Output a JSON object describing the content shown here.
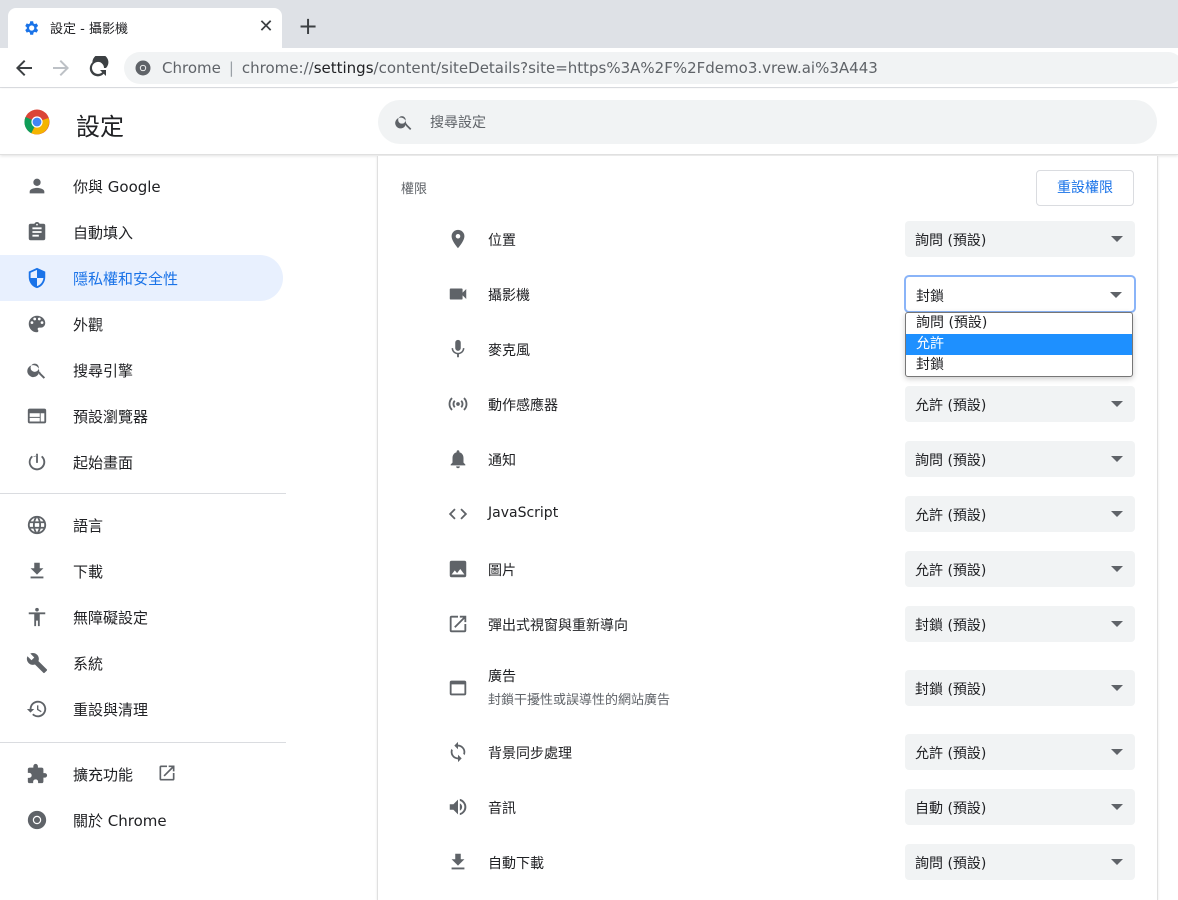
{
  "tab": {
    "title": "設定 - 攝影機",
    "close": "✕"
  },
  "newtab": "+",
  "omnibox": {
    "prefix": "Chrome",
    "separator": "|",
    "scheme": "chrome://",
    "host": "settings",
    "path": "/content/siteDetails?site=https%3A%2F%2Fdemo3.vrew.ai%3A443"
  },
  "header": {
    "title": "設定",
    "search_placeholder": "搜尋設定"
  },
  "sidebar": {
    "items": [
      {
        "label": "你與 Google",
        "icon": "person-icon"
      },
      {
        "label": "自動填入",
        "icon": "clipboard-icon"
      },
      {
        "label": "隱私權和安全性",
        "icon": "shield-icon"
      },
      {
        "label": "外觀",
        "icon": "palette-icon"
      },
      {
        "label": "搜尋引擎",
        "icon": "search-icon"
      },
      {
        "label": "預設瀏覽器",
        "icon": "browser-icon"
      },
      {
        "label": "起始畫面",
        "icon": "power-icon"
      },
      {
        "label": "語言",
        "icon": "globe-icon"
      },
      {
        "label": "下載",
        "icon": "download-icon"
      },
      {
        "label": "無障礙設定",
        "icon": "accessibility-icon"
      },
      {
        "label": "系統",
        "icon": "wrench-icon"
      },
      {
        "label": "重設與清理",
        "icon": "history-icon"
      },
      {
        "label": "擴充功能",
        "icon": "puzzle-icon"
      },
      {
        "label": "關於 Chrome",
        "icon": "chrome-icon"
      }
    ],
    "active_index": 2
  },
  "permissions": {
    "section_title": "權限",
    "reset_label": "重設權限",
    "rows": [
      {
        "label": "位置",
        "value": "詢問 (預設)",
        "icon": "location-icon"
      },
      {
        "label": "攝影機",
        "value": "封鎖",
        "icon": "camera-icon"
      },
      {
        "label": "麥克風",
        "value": "",
        "icon": "mic-icon"
      },
      {
        "label": "動作感應器",
        "value": "允許 (預設)",
        "icon": "sensors-icon"
      },
      {
        "label": "通知",
        "value": "詢問 (預設)",
        "icon": "bell-icon"
      },
      {
        "label": "JavaScript",
        "value": "允許 (預設)",
        "icon": "code-icon"
      },
      {
        "label": "圖片",
        "value": "允許 (預設)",
        "icon": "image-icon"
      },
      {
        "label": "彈出式視窗與重新導向",
        "value": "封鎖 (預設)",
        "icon": "open-in-new-icon"
      },
      {
        "label": "廣告",
        "sublabel": "封鎖干擾性或誤導性的網站廣告",
        "value": "封鎖 (預設)",
        "icon": "ads-icon"
      },
      {
        "label": "背景同步處理",
        "value": "允許 (預設)",
        "icon": "sync-icon"
      },
      {
        "label": "音訊",
        "value": "自動 (預設)",
        "icon": "volume-icon"
      },
      {
        "label": "自動下載",
        "value": "詢問 (預設)",
        "icon": "download-icon"
      }
    ]
  },
  "dropdown": {
    "options": [
      "詢問 (預設)",
      "允許",
      "封鎖"
    ],
    "highlighted_index": 1
  },
  "colors": {
    "accent": "#1a73e8",
    "active_bg": "#e8f0fe",
    "highlight": "#1e90ff"
  }
}
